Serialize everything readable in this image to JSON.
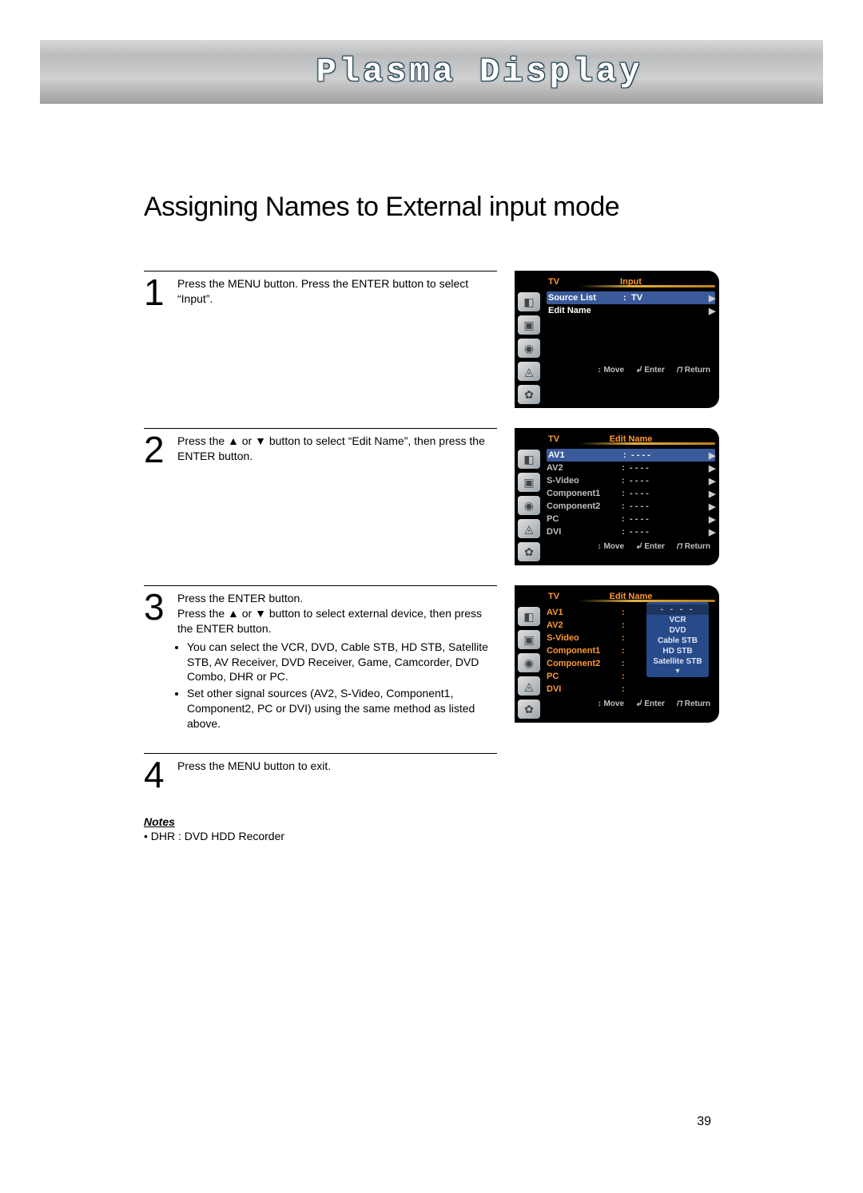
{
  "banner": {
    "title": "Plasma Display"
  },
  "headline": "Assigning Names to External input mode",
  "steps": {
    "s1": {
      "num": "1",
      "text": "Press the MENU button. Press the ENTER button to select “Input”."
    },
    "s2": {
      "num": "2",
      "text": "Press the ▲ or ▼ button to select “Edit Name”, then press the ENTER button."
    },
    "s3": {
      "num": "3",
      "line1": "Press the ENTER button.",
      "line2": "Press the ▲ or ▼ button to select external device, then press the ENTER button.",
      "bullet1": "You can select the VCR, DVD, Cable STB, HD STB, Satellite STB, AV Receiver, DVD Receiver, Game, Camcorder, DVD Combo, DHR or PC.",
      "bullet2": "Set other signal sources (AV2, S-Video, Component1, Component2, PC or DVI) using the same method as listed above."
    },
    "s4": {
      "num": "4",
      "text": "Press the MENU button to exit."
    }
  },
  "notes": {
    "title": "Notes",
    "item1": "DHR : DVD HDD Recorder"
  },
  "page_number": "39",
  "osd_common": {
    "source_tag": "TV",
    "footer_move": "Move",
    "footer_enter": "Enter",
    "footer_return": "Return",
    "arrow": "▶",
    "colon": ":",
    "dashes": "- - - -",
    "move_glyph": "↕",
    "enter_glyph": "↲",
    "return_glyph": "⊓"
  },
  "osd1": {
    "title": "Input",
    "row1_label": "Source List",
    "row1_value": "TV",
    "row2_label": "Edit Name"
  },
  "osd2": {
    "title": "Edit Name",
    "rows": {
      "r1": "AV1",
      "r2": "AV2",
      "r3": "S-Video",
      "r4": "Component1",
      "r5": "Component2",
      "r6": "PC",
      "r7": "DVI"
    }
  },
  "osd3": {
    "title": "Edit Name",
    "rows": {
      "r1": "AV1",
      "r2": "AV2",
      "r3": "S-Video",
      "r4": "Component1",
      "r5": "Component2",
      "r6": "PC",
      "r7": "DVI"
    },
    "popup": {
      "p0": "- - - -",
      "p1": "VCR",
      "p2": "DVD",
      "p3": "Cable STB",
      "p4": "HD STB",
      "p5": "Satellite STB",
      "down": "▼"
    }
  }
}
